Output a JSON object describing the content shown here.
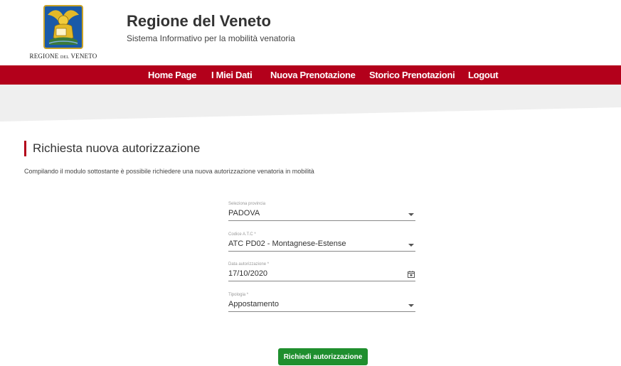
{
  "header": {
    "logo_text_a": "REGIONE",
    "logo_text_b": "DEL",
    "logo_text_c": "VENETO",
    "title": "Regione del Veneto",
    "subtitle": "Sistema Informativo per la mobilità venatoria"
  },
  "nav": {
    "items": [
      {
        "label": "Home Page"
      },
      {
        "label": "I Miei Dati"
      },
      {
        "label": "Nuova Prenotazione"
      },
      {
        "label": "Storico Prenotazioni"
      },
      {
        "label": "Logout"
      }
    ]
  },
  "form": {
    "section_title": "Richiesta nuova autorizzazione",
    "intro": "Compilando il modulo sottostante è possibile richiedere una nuova autorizzazione venatoria in mobilità",
    "provincia": {
      "label": "Seleziona provincia",
      "value": "PADOVA"
    },
    "atc": {
      "label": "Codice A.T.C *",
      "value": "ATC PD02 - Montagnese-Estense"
    },
    "data": {
      "label": "Data autorizzazione *",
      "value": "17/10/2020"
    },
    "tipologia": {
      "label": "Tipologia *",
      "value": "Appostamento"
    },
    "submit_label": "Richiedi autorizzazione"
  },
  "colors": {
    "brand_red": "#b3001b",
    "submit_green": "#1f8f2e",
    "band_gray": "#efefef"
  }
}
